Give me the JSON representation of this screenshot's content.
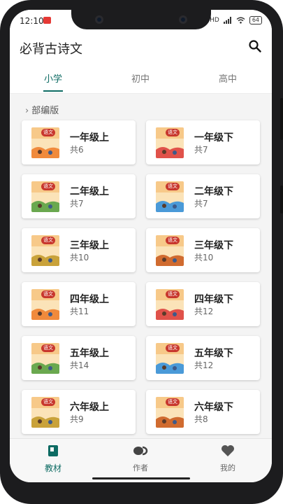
{
  "status_bar": {
    "time": "12:10",
    "network": "HD",
    "battery": "64"
  },
  "app": {
    "title": "必背古诗文"
  },
  "tabs": [
    {
      "label": "小学",
      "active": true
    },
    {
      "label": "初中",
      "active": false
    },
    {
      "label": "高中",
      "active": false
    }
  ],
  "section": {
    "title": "部编版"
  },
  "books": [
    {
      "grade": "一年级上",
      "count": "共6"
    },
    {
      "grade": "一年级下",
      "count": "共7"
    },
    {
      "grade": "二年级上",
      "count": "共7"
    },
    {
      "grade": "二年级下",
      "count": "共7"
    },
    {
      "grade": "三年级上",
      "count": "共10"
    },
    {
      "grade": "三年级下",
      "count": "共10"
    },
    {
      "grade": "四年级上",
      "count": "共11"
    },
    {
      "grade": "四年级下",
      "count": "共12"
    },
    {
      "grade": "五年级上",
      "count": "共14"
    },
    {
      "grade": "五年级下",
      "count": "共12"
    },
    {
      "grade": "六年级上",
      "count": "共9"
    },
    {
      "grade": "六年级下",
      "count": "共8"
    }
  ],
  "cover_logo": "语文",
  "bottom_nav": [
    {
      "label": "教材",
      "icon": "book-icon",
      "active": true
    },
    {
      "label": "作者",
      "icon": "author-icon",
      "active": false
    },
    {
      "label": "我的",
      "icon": "heart-icon",
      "active": false
    }
  ],
  "colors": {
    "accent": "#0d6b63",
    "background": "#f4f4f4"
  }
}
